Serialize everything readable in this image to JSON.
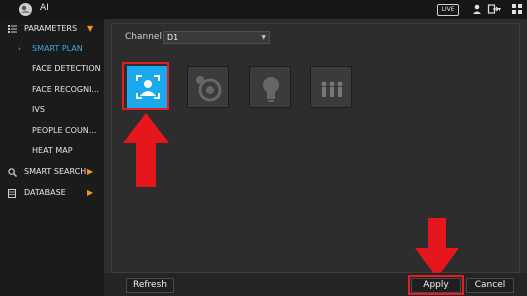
{
  "topbar": {
    "title": "AI",
    "live_label": "LIVE",
    "icons": [
      "logo-icon",
      "user-icon",
      "exit-icon",
      "grid-icon"
    ]
  },
  "sidebar": {
    "sections": [
      {
        "label": "PARAMETERS",
        "icon": "list-icon",
        "expanded": true
      },
      {
        "label": "SMART SEARCH",
        "icon": "search-icon",
        "expanded": false
      },
      {
        "label": "DATABASE",
        "icon": "database-icon",
        "expanded": false
      }
    ],
    "items": [
      {
        "label": "SMART PLAN",
        "selected": true
      },
      {
        "label": "FACE DETECTION",
        "selected": false
      },
      {
        "label": "FACE RECOGNI...",
        "selected": false
      },
      {
        "label": "IVS",
        "selected": false
      },
      {
        "label": "PEOPLE COUN...",
        "selected": false
      },
      {
        "label": "HEAT MAP",
        "selected": false
      }
    ]
  },
  "main": {
    "channel_label": "Channel",
    "channel_value": "D1",
    "plans": [
      {
        "icon": "face-detection-icon",
        "active": true
      },
      {
        "icon": "camera-lens-icon",
        "active": false
      },
      {
        "icon": "lightbulb-icon",
        "active": false
      },
      {
        "icon": "people-counting-icon",
        "active": false
      }
    ]
  },
  "footer": {
    "refresh_label": "Refresh",
    "apply_label": "Apply",
    "cancel_label": "Cancel"
  },
  "colors": {
    "accent": "#1aa8ee",
    "highlight": "#e01e24",
    "arrow": "#f7941d",
    "selected_text": "#3aa9e8"
  }
}
